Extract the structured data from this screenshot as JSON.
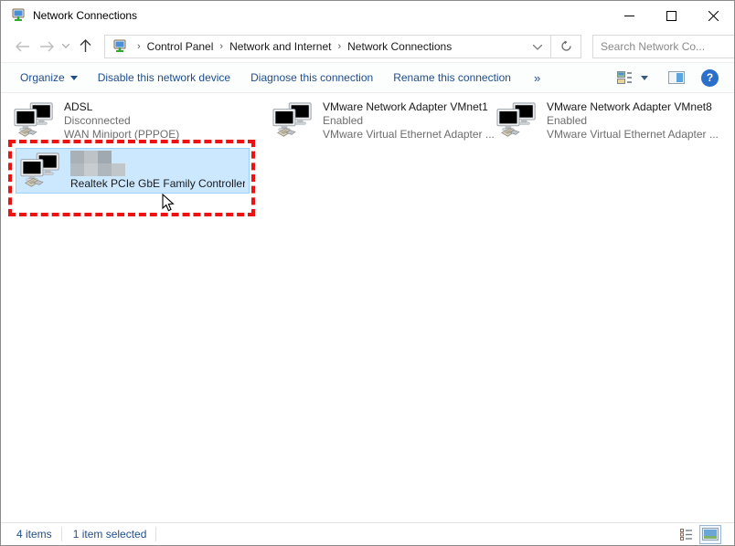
{
  "window": {
    "title": "Network Connections"
  },
  "titlebar": {
    "minimize": "—",
    "maximize": "□",
    "close": "✕"
  },
  "navbar": {
    "breadcrumb": [
      "Control Panel",
      "Network and Internet",
      "Network Connections"
    ],
    "chevron": "›",
    "search_placeholder": "Search Network Co...",
    "search_value": ""
  },
  "toolbar": {
    "organize": "Organize",
    "disable": "Disable this network device",
    "diagnose": "Diagnose this connection",
    "rename": "Rename this connection",
    "more": "»"
  },
  "items": [
    {
      "name": "ADSL",
      "status": "Disconnected",
      "device": "WAN Miniport (PPPOE)",
      "state": "disabled",
      "selected": false
    },
    {
      "name": "VMware Network Adapter VMnet1",
      "status": "Enabled",
      "device": "VMware Virtual Ethernet Adapter ...",
      "state": "enabled",
      "selected": false
    },
    {
      "name": "VMware Network Adapter VMnet8",
      "status": "Enabled",
      "device": "VMware Virtual Ethernet Adapter ...",
      "state": "enabled",
      "selected": false
    },
    {
      "name_blurred": true,
      "status_blurred": true,
      "device": "Realtek PCIe GbE Family Controller",
      "state": "enabled",
      "selected": true
    }
  ],
  "statusbar": {
    "items_count": "4 items",
    "selected_count": "1 item selected"
  },
  "colors": {
    "selection_bg": "#cce8ff",
    "selection_border": "#98d1fd",
    "annotation_red": "#ee1111",
    "toolbar_text": "#1f4e8c",
    "help_blue": "#2a6fc9"
  }
}
